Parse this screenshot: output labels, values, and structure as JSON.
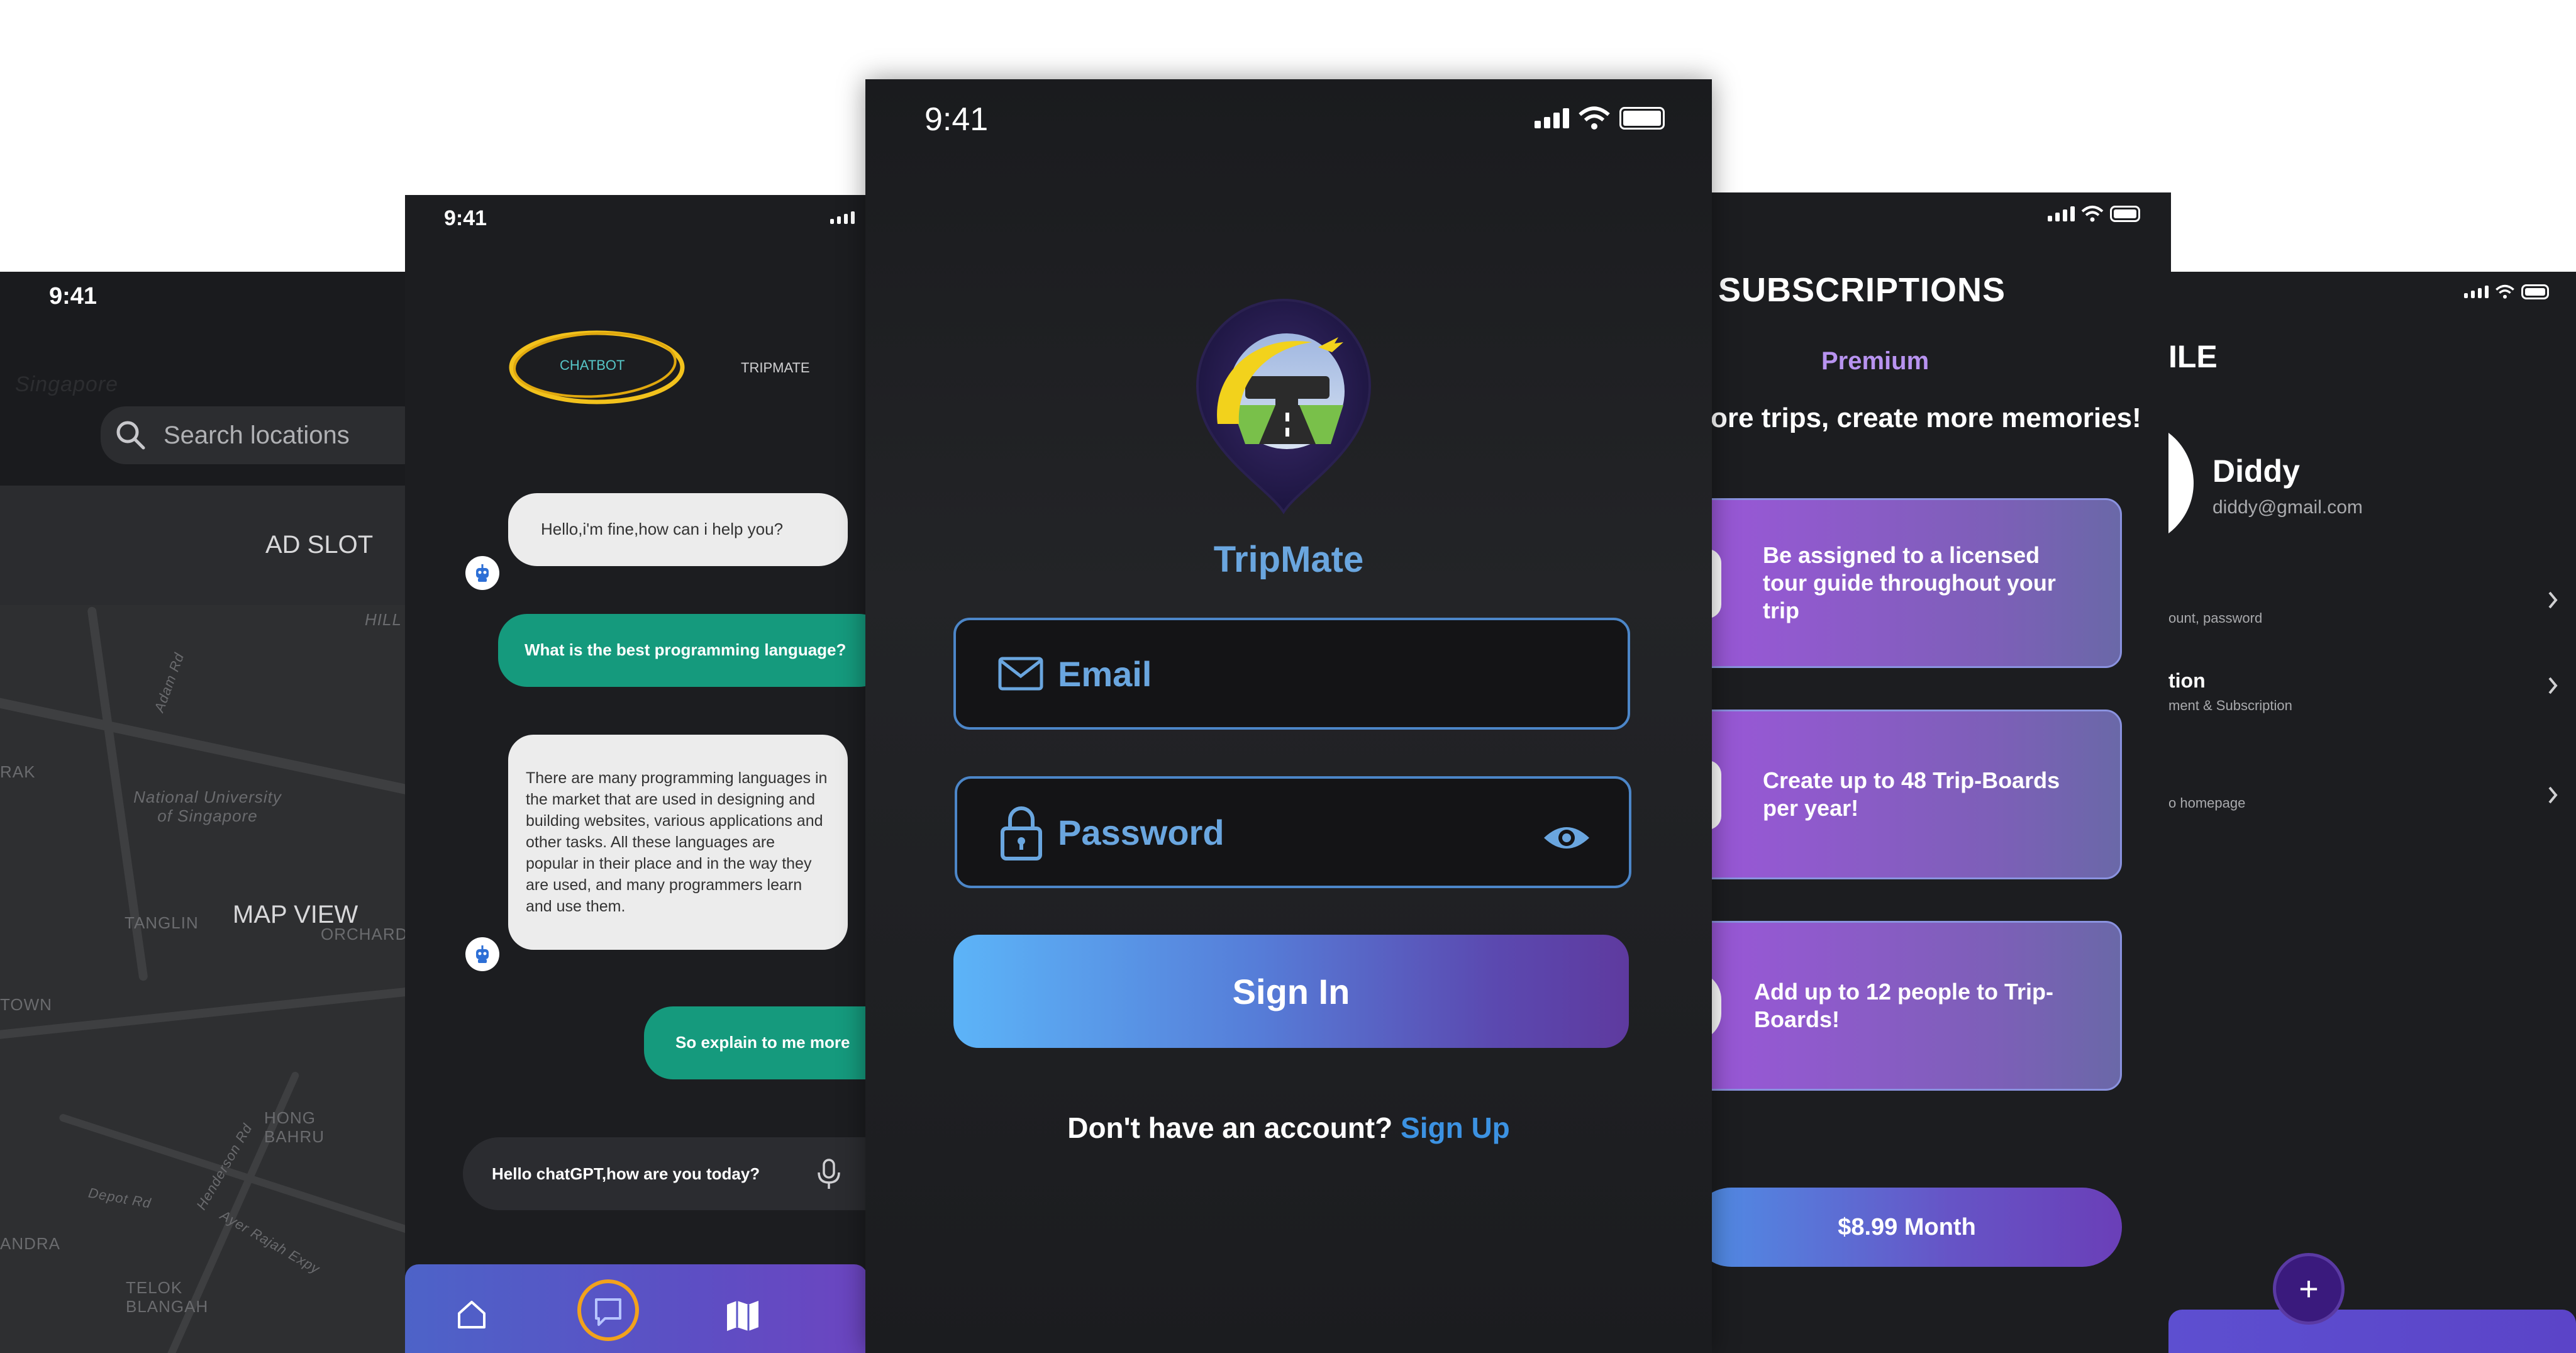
{
  "status_time": "9:41",
  "map_screen": {
    "search_placeholder": "Search locations",
    "ad_slot": "AD SLOT",
    "map_view": "MAP VIEW",
    "map_labels": [
      "Singapore",
      "National University of Singapore",
      "TANGLIN",
      "ORCHARD",
      "TOWN",
      "RAK",
      "HONG BAHRU",
      "TELOK BLANGAH",
      "ANDRA",
      "Adam Rd",
      "Depot Rd",
      "Henderson Rd",
      "Ayer Rajah Expy",
      "HILL"
    ]
  },
  "chat_screen": {
    "tabs": [
      "CHATBOT",
      "TRIPMATE"
    ],
    "messages": [
      {
        "from": "bot",
        "text": "Hello,i'm fine,how can i help you?"
      },
      {
        "from": "user",
        "text": "What is the best programming language?"
      },
      {
        "from": "bot",
        "text": "There are many programming languages in the market that are used in designing and building websites, various applications and other tasks. All these languages are popular in their place and in the way they are used, and many programmers learn and use them."
      },
      {
        "from": "user",
        "text": "So explain to me more"
      }
    ],
    "input_value": "Hello chatGPT,how are you today?",
    "nav_icons": [
      "home-icon",
      "chat-icon",
      "map-icon"
    ]
  },
  "signin_screen": {
    "brand": "TripMate",
    "email_placeholder": "Email",
    "password_placeholder": "Password",
    "sign_in_label": "Sign In",
    "no_account_text": "Don't have an account?",
    "sign_up_label": "Sign Up",
    "accent_color": "#3c92e2"
  },
  "subscriptions_screen": {
    "title": "SUBSCRIPTIONS",
    "plan": "Premium",
    "tagline": "ore trips, create more memories!",
    "features": [
      "Be assigned to a licensed tour guide throughout your trip",
      "Create up to 48 Trip-Boards per year!",
      "Add up to 12 people to Trip-Boards!"
    ],
    "price_label": "$8.99 Month"
  },
  "profile_screen": {
    "title": "ILE",
    "name": "Diddy",
    "email": "diddy@gmail.com",
    "rows": [
      {
        "main": "",
        "sub": "ount, password"
      },
      {
        "main": "tion",
        "sub": "ment & Subscription"
      },
      {
        "main": "",
        "sub": "o homepage"
      }
    ],
    "fab_label": "+"
  }
}
